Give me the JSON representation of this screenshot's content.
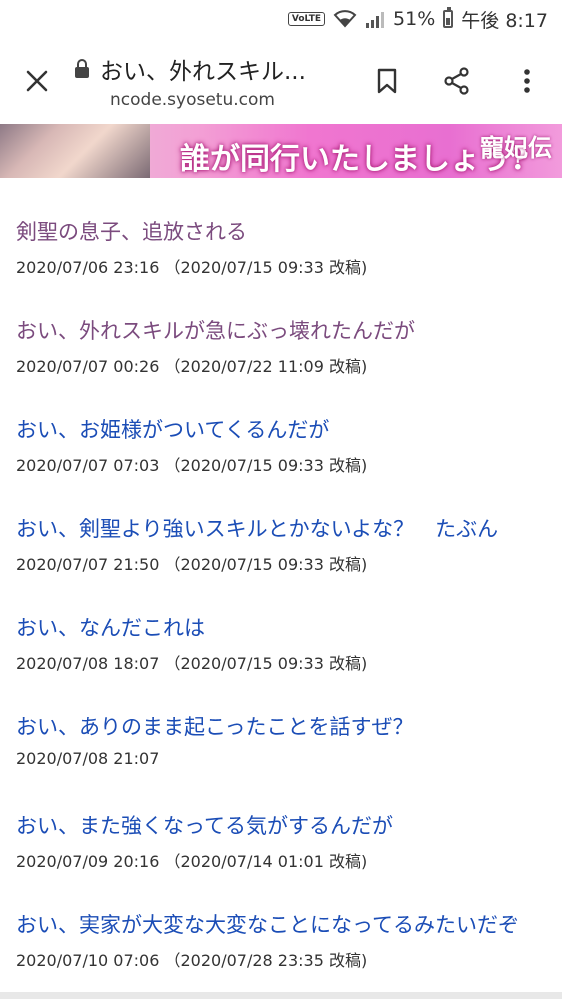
{
  "status_bar": {
    "volte": "VoLTE",
    "battery": "51%",
    "time": "午後 8:17"
  },
  "toolbar": {
    "title": "おい、外れスキル...",
    "url": "ncode.syosetu.com"
  },
  "banner": {
    "line1": "誰が同行いたしましょう?",
    "logo": "寵妃伝"
  },
  "chapters": [
    {
      "title": "剣聖の息子、追放される",
      "date": "2020/07/06 23:16 （2020/07/15 09:33 改稿)",
      "visited": true
    },
    {
      "title": "おい、外れスキルが急にぶっ壊れたんだが",
      "date": "2020/07/07 00:26 （2020/07/22 11:09 改稿)",
      "visited": true
    },
    {
      "title": "おい、お姫様がついてくるんだが",
      "date": "2020/07/07 07:03 （2020/07/15 09:33 改稿)",
      "visited": false
    },
    {
      "title": "おい、剣聖より強いスキルとかないよな？　たぶん",
      "date": "2020/07/07 21:50 （2020/07/15 09:33 改稿)",
      "visited": false
    },
    {
      "title": "おい、なんだこれは",
      "date": "2020/07/08 18:07 （2020/07/15 09:33 改稿)",
      "visited": false
    },
    {
      "title": "おい、ありのまま起こったことを話すぜ？",
      "date": "2020/07/08 21:07",
      "visited": false
    },
    {
      "title": "おい、また強くなってる気がするんだが",
      "date": "2020/07/09 20:16 （2020/07/14 01:01 改稿)",
      "visited": false
    },
    {
      "title": "おい、実家が大変な大変なことになってるみたいだぞ",
      "date": "2020/07/10 07:06 （2020/07/28 23:35 改稿)",
      "visited": false
    }
  ]
}
